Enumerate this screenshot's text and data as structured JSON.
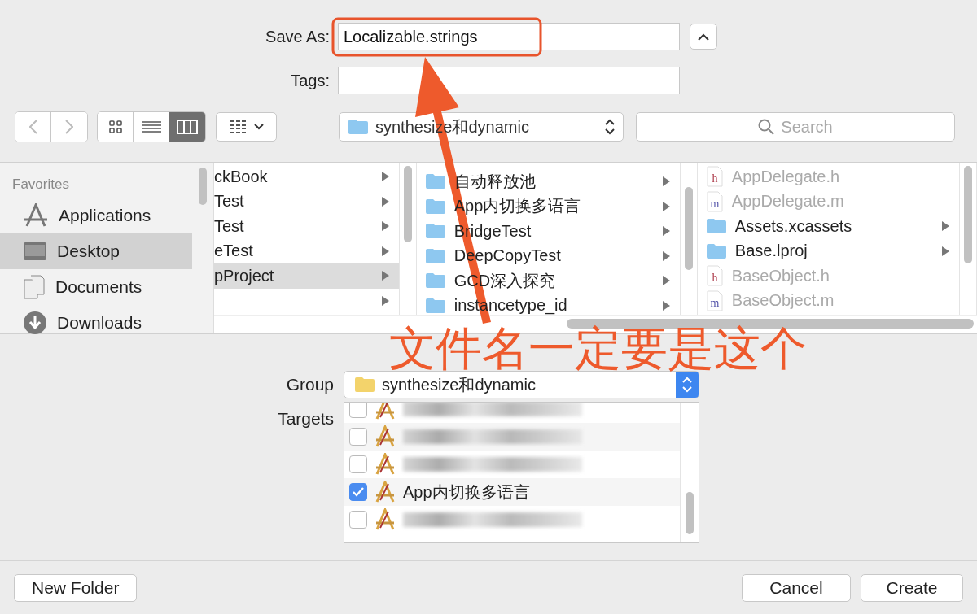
{
  "save_as": {
    "label": "Save As:",
    "value": "Localizable.strings"
  },
  "tags": {
    "label": "Tags:"
  },
  "toolbar": {
    "views": [
      {
        "kind": "icons",
        "selected": false
      },
      {
        "kind": "list",
        "selected": false
      },
      {
        "kind": "columns",
        "selected": true
      }
    ],
    "path": "synthesize和dynamic",
    "search": {
      "placeholder": "Search"
    }
  },
  "sidebar": {
    "heading": "Favorites",
    "items": [
      {
        "kind": "applications",
        "label": "Applications",
        "selected": false
      },
      {
        "kind": "desktop",
        "label": "Desktop",
        "selected": true
      },
      {
        "kind": "documents",
        "label": "Documents",
        "selected": false
      },
      {
        "kind": "downloads",
        "label": "Downloads",
        "selected": false
      }
    ]
  },
  "columns": [
    {
      "cut": true,
      "items": [
        {
          "name": "ckBook",
          "kind": "folder",
          "selected": false
        },
        {
          "name": "Test",
          "kind": "folder",
          "selected": false
        },
        {
          "name": "Test",
          "kind": "folder",
          "selected": false
        },
        {
          "name": "eTest",
          "kind": "folder",
          "selected": false
        },
        {
          "name": "pProject",
          "kind": "folder",
          "selected": true
        },
        {
          "kind": "folder",
          "selected": false
        }
      ]
    },
    {
      "cut": false,
      "items": [
        {
          "name": "自动释放池",
          "kind": "folder",
          "selected": false
        },
        {
          "name": "App内切换多语言",
          "kind": "folder",
          "selected": false
        },
        {
          "name": "BridgeTest",
          "kind": "folder",
          "selected": false
        },
        {
          "name": "DeepCopyTest",
          "kind": "folder",
          "selected": false
        },
        {
          "name": "GCD深入探究",
          "kind": "folder",
          "selected": false
        },
        {
          "name": "instancetype_id",
          "kind": "folder",
          "selected": false
        }
      ]
    },
    {
      "cut": false,
      "items": [
        {
          "name": "AppDelegate.h",
          "kind": "h",
          "selected": false
        },
        {
          "name": "AppDelegate.m",
          "kind": "m",
          "selected": false
        },
        {
          "name": "Assets.xcassets",
          "kind": "folder",
          "selected": false
        },
        {
          "name": "Base.lproj",
          "kind": "folder",
          "selected": false
        },
        {
          "name": "BaseObject.h",
          "kind": "h",
          "selected": false
        },
        {
          "name": "BaseObject.m",
          "kind": "m",
          "selected": false
        }
      ]
    }
  ],
  "group": {
    "label": "Group",
    "value": "synthesize和dynamic"
  },
  "targets": {
    "label": "Targets",
    "rows": [
      {
        "kind": "redacted",
        "checked": false
      },
      {
        "kind": "redacted",
        "checked": false
      },
      {
        "kind": "redacted",
        "checked": false
      },
      {
        "kind": "named",
        "name": "App内切换多语言",
        "checked": true
      },
      {
        "kind": "redacted",
        "checked": false
      }
    ]
  },
  "buttons": {
    "new_folder": "New Folder",
    "cancel": "Cancel",
    "create": "Create"
  },
  "annotation": {
    "text": "文件名一定要是这个"
  }
}
